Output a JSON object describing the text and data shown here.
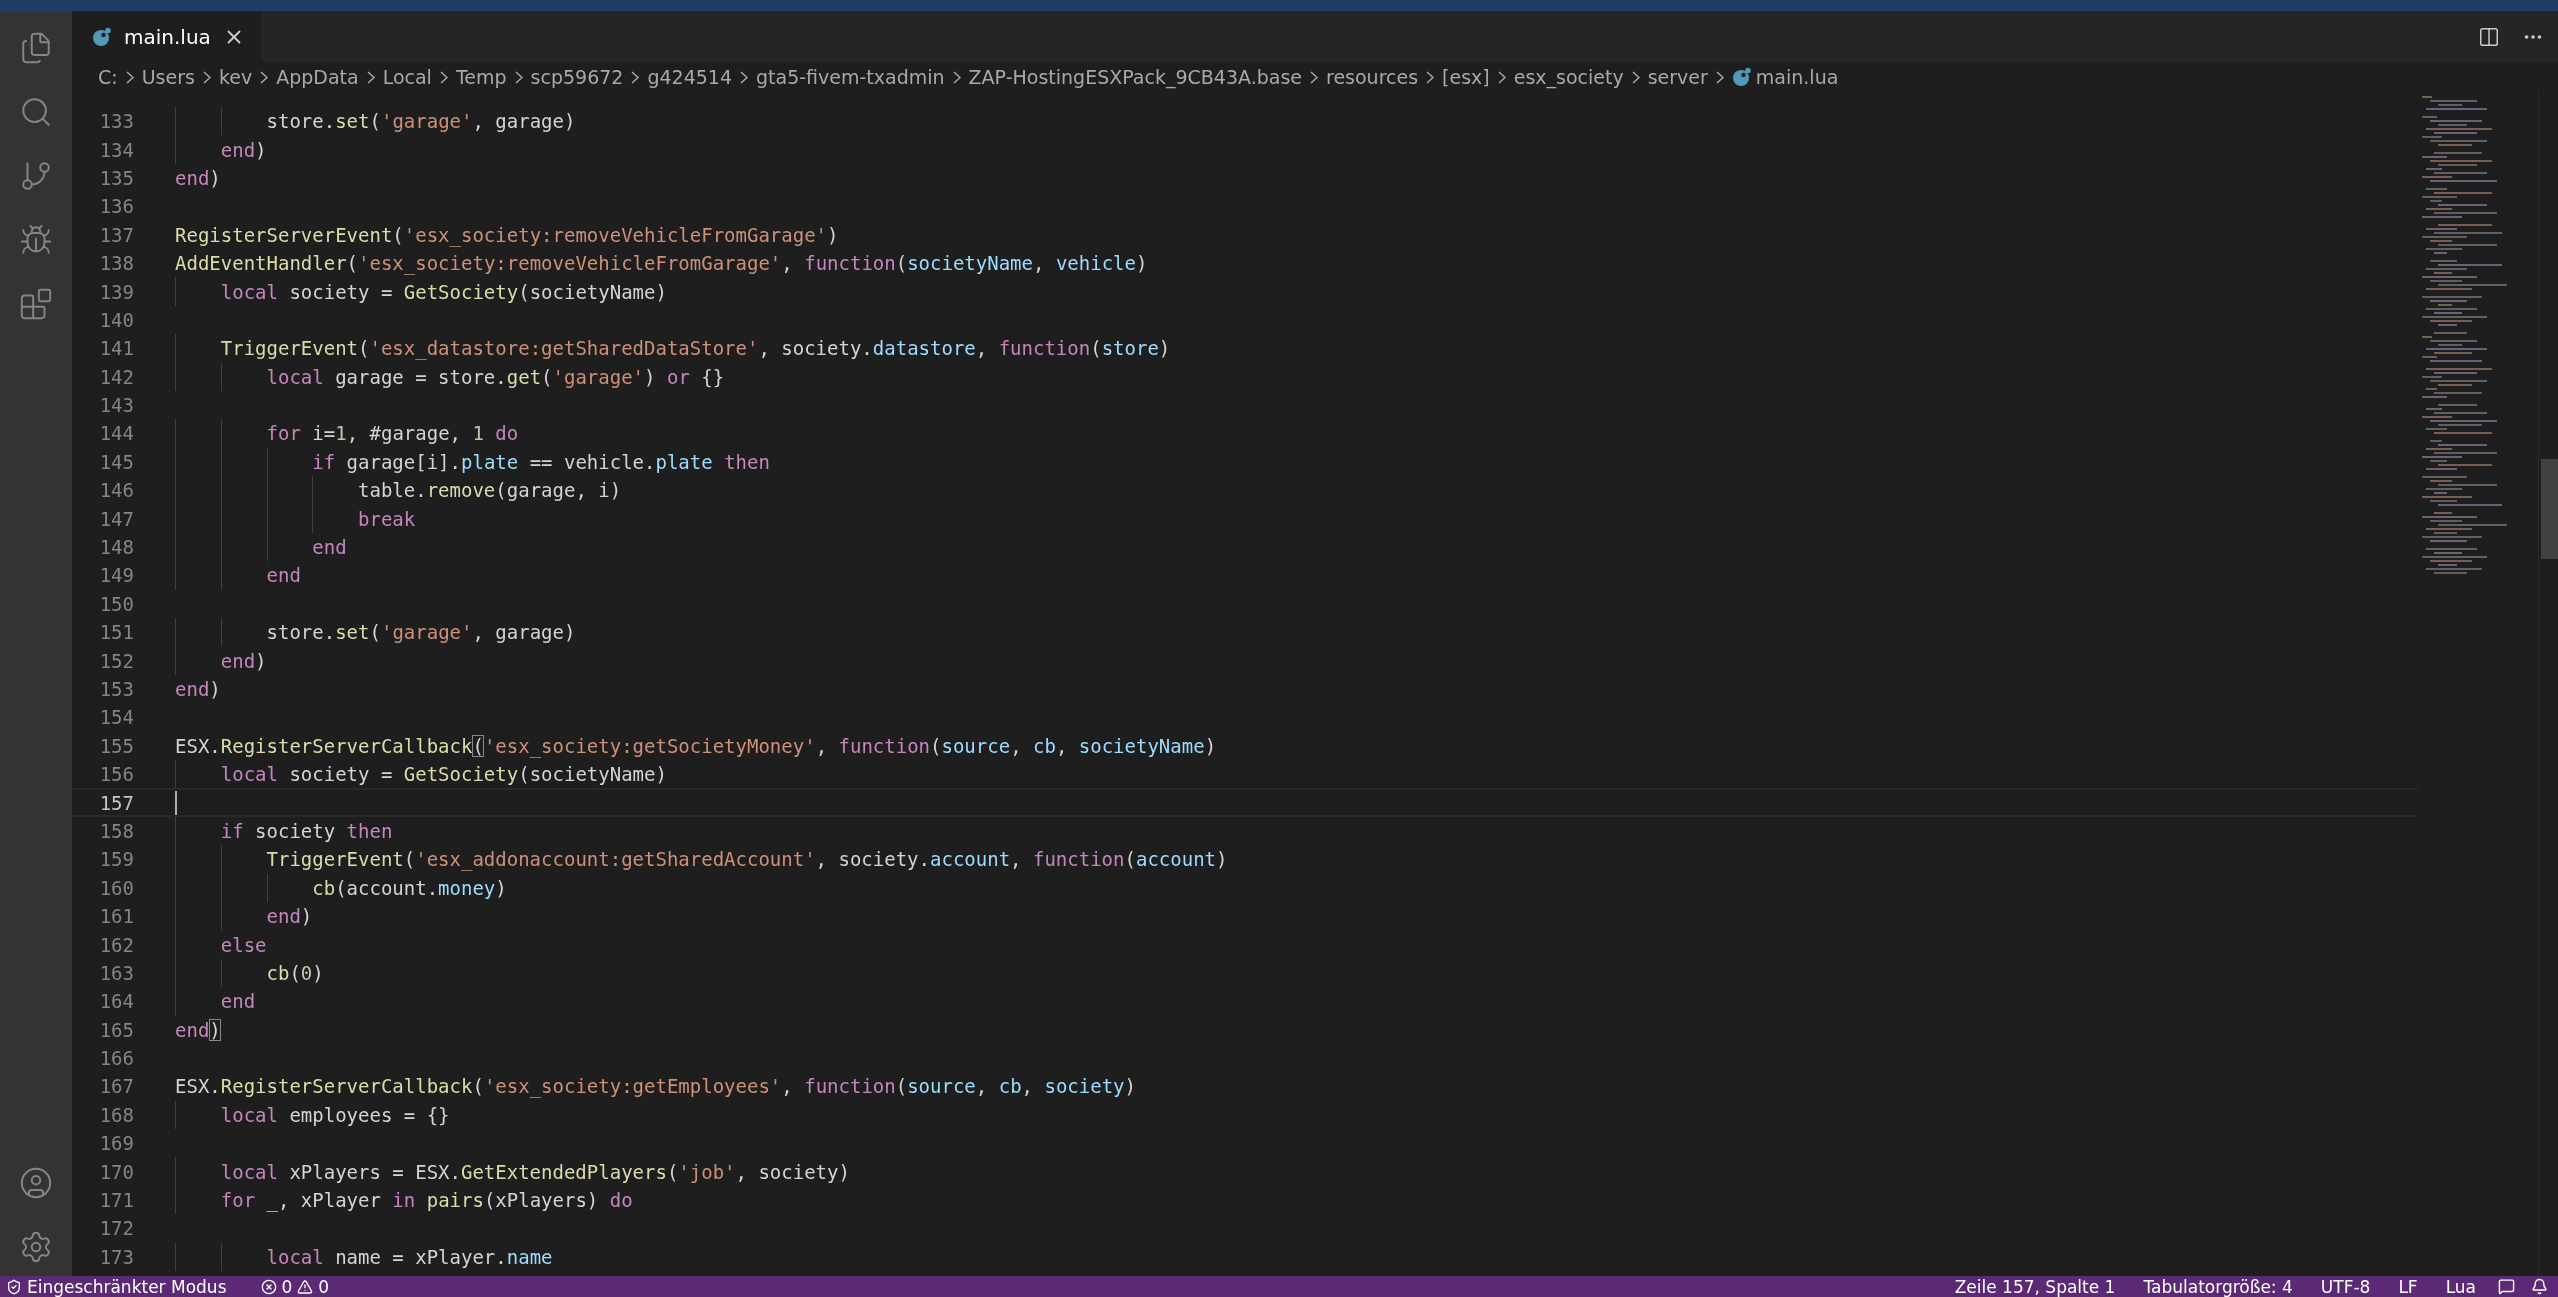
{
  "tabs": [
    {
      "label": "main.lua",
      "selected": true
    }
  ],
  "breadcrumbs": [
    "C:",
    "Users",
    "kev",
    "AppData",
    "Local",
    "Temp",
    "scp59672",
    "g424514",
    "gta5-fivem-txadmin",
    "ZAP-HostingESXPack_9CB43A.base",
    "resources",
    "[esx]",
    "esx_society",
    "server",
    "main.lua"
  ],
  "lines": [
    {
      "number": "133",
      "current": false,
      "tokens": [
        {
          "kind": "plain",
          "text": "        store."
        },
        {
          "kind": "fn",
          "text": "set"
        },
        {
          "kind": "plain",
          "text": "("
        },
        {
          "kind": "str",
          "text": "'garage'"
        },
        {
          "kind": "plain",
          "text": ", garage)"
        }
      ]
    },
    {
      "number": "134",
      "current": false,
      "tokens": [
        {
          "kind": "kw",
          "text": "    end"
        },
        {
          "kind": "plain",
          "text": ")"
        }
      ]
    },
    {
      "number": "135",
      "current": false,
      "tokens": [
        {
          "kind": "kw",
          "text": "end"
        },
        {
          "kind": "plain",
          "text": ")"
        }
      ]
    },
    {
      "number": "136",
      "current": false
    },
    {
      "number": "137",
      "current": false,
      "tokens": [
        {
          "kind": "fn",
          "text": "RegisterServerEvent"
        },
        {
          "kind": "plain",
          "text": "("
        },
        {
          "kind": "str",
          "text": "'esx_society:removeVehicleFromGarage'"
        },
        {
          "kind": "plain",
          "text": ")"
        }
      ]
    },
    {
      "number": "138",
      "current": false,
      "tokens": [
        {
          "kind": "fn",
          "text": "AddEventHandler"
        },
        {
          "kind": "plain",
          "text": "("
        },
        {
          "kind": "str",
          "text": "'esx_society:removeVehicleFromGarage'"
        },
        {
          "kind": "plain",
          "text": ", "
        },
        {
          "kind": "kw",
          "text": "function"
        },
        {
          "kind": "plain",
          "text": "("
        },
        {
          "kind": "var",
          "text": "societyName"
        },
        {
          "kind": "plain",
          "text": ", "
        },
        {
          "kind": "var",
          "text": "vehicle"
        },
        {
          "kind": "plain",
          "text": ")"
        }
      ]
    },
    {
      "number": "139",
      "current": false,
      "tokens": [
        {
          "kind": "kw",
          "text": "    local"
        },
        {
          "kind": "plain",
          "text": " society = "
        },
        {
          "kind": "fn",
          "text": "GetSociety"
        },
        {
          "kind": "plain",
          "text": "(societyName)"
        }
      ]
    },
    {
      "number": "140",
      "current": false
    },
    {
      "number": "141",
      "current": false,
      "tokens": [
        {
          "kind": "fn",
          "text": "    TriggerEvent"
        },
        {
          "kind": "plain",
          "text": "("
        },
        {
          "kind": "str",
          "text": "'esx_datastore:getSharedDataStore'"
        },
        {
          "kind": "plain",
          "text": ", society."
        },
        {
          "kind": "var",
          "text": "datastore"
        },
        {
          "kind": "plain",
          "text": ", "
        },
        {
          "kind": "kw",
          "text": "function"
        },
        {
          "kind": "plain",
          "text": "("
        },
        {
          "kind": "var",
          "text": "store"
        },
        {
          "kind": "plain",
          "text": ")"
        }
      ]
    },
    {
      "number": "142",
      "current": false,
      "tokens": [
        {
          "kind": "kw",
          "text": "        local"
        },
        {
          "kind": "plain",
          "text": " garage = store."
        },
        {
          "kind": "fn",
          "text": "get"
        },
        {
          "kind": "plain",
          "text": "("
        },
        {
          "kind": "str",
          "text": "'garage'"
        },
        {
          "kind": "plain",
          "text": ") "
        },
        {
          "kind": "kw",
          "text": "or"
        },
        {
          "kind": "plain",
          "text": " {}"
        }
      ]
    },
    {
      "number": "143",
      "current": false
    },
    {
      "number": "144",
      "current": false,
      "tokens": [
        {
          "kind": "kw",
          "text": "        for"
        },
        {
          "kind": "plain",
          "text": " i="
        },
        {
          "kind": "num",
          "text": "1"
        },
        {
          "kind": "plain",
          "text": ", #garage, "
        },
        {
          "kind": "num",
          "text": "1"
        },
        {
          "kind": "kw",
          "text": " do"
        }
      ]
    },
    {
      "number": "145",
      "current": false,
      "tokens": [
        {
          "kind": "kw",
          "text": "            if"
        },
        {
          "kind": "plain",
          "text": " garage[i]."
        },
        {
          "kind": "var",
          "text": "plate"
        },
        {
          "kind": "plain",
          "text": " == vehicle."
        },
        {
          "kind": "var",
          "text": "plate"
        },
        {
          "kind": "kw",
          "text": " then"
        }
      ]
    },
    {
      "number": "146",
      "current": false,
      "tokens": [
        {
          "kind": "plain",
          "text": "                table."
        },
        {
          "kind": "fn",
          "text": "remove"
        },
        {
          "kind": "plain",
          "text": "(garage, i)"
        }
      ]
    },
    {
      "number": "147",
      "current": false,
      "tokens": [
        {
          "kind": "kw",
          "text": "                break"
        }
      ]
    },
    {
      "number": "148",
      "current": false,
      "tokens": [
        {
          "kind": "kw",
          "text": "            end"
        }
      ]
    },
    {
      "number": "149",
      "current": false,
      "tokens": [
        {
          "kind": "kw",
          "text": "        end"
        }
      ]
    },
    {
      "number": "150",
      "current": false
    },
    {
      "number": "151",
      "current": false,
      "tokens": [
        {
          "kind": "plain",
          "text": "        store."
        },
        {
          "kind": "fn",
          "text": "set"
        },
        {
          "kind": "plain",
          "text": "("
        },
        {
          "kind": "str",
          "text": "'garage'"
        },
        {
          "kind": "plain",
          "text": ", garage)"
        }
      ]
    },
    {
      "number": "152",
      "current": false,
      "tokens": [
        {
          "kind": "kw",
          "text": "    end"
        },
        {
          "kind": "plain",
          "text": ")"
        }
      ]
    },
    {
      "number": "153",
      "current": false,
      "tokens": [
        {
          "kind": "kw",
          "text": "end"
        },
        {
          "kind": "plain",
          "text": ")"
        }
      ]
    },
    {
      "number": "154",
      "current": false
    },
    {
      "number": "155",
      "current": false,
      "tokens": [
        {
          "kind": "plain",
          "text": "ESX."
        },
        {
          "kind": "fn",
          "text": "RegisterServerCallback"
        },
        {
          "kind": "bracket",
          "text": "("
        },
        {
          "kind": "str",
          "text": "'esx_society:getSocietyMoney'"
        },
        {
          "kind": "plain",
          "text": ", "
        },
        {
          "kind": "kw",
          "text": "function"
        },
        {
          "kind": "plain",
          "text": "("
        },
        {
          "kind": "var",
          "text": "source"
        },
        {
          "kind": "plain",
          "text": ", "
        },
        {
          "kind": "var",
          "text": "cb"
        },
        {
          "kind": "plain",
          "text": ", "
        },
        {
          "kind": "var",
          "text": "societyName"
        },
        {
          "kind": "plain",
          "text": ")"
        }
      ]
    },
    {
      "number": "156",
      "current": false,
      "tokens": [
        {
          "kind": "kw",
          "text": "    local"
        },
        {
          "kind": "plain",
          "text": " society = "
        },
        {
          "kind": "fn",
          "text": "GetSociety"
        },
        {
          "kind": "plain",
          "text": "(societyName)"
        }
      ]
    },
    {
      "number": "157",
      "current": true
    },
    {
      "number": "158",
      "current": false,
      "tokens": [
        {
          "kind": "kw",
          "text": "    if"
        },
        {
          "kind": "plain",
          "text": " society "
        },
        {
          "kind": "kw",
          "text": "then"
        }
      ]
    },
    {
      "number": "159",
      "current": false,
      "tokens": [
        {
          "kind": "fn",
          "text": "        TriggerEvent"
        },
        {
          "kind": "plain",
          "text": "("
        },
        {
          "kind": "str",
          "text": "'esx_addonaccount:getSharedAccount'"
        },
        {
          "kind": "plain",
          "text": ", society."
        },
        {
          "kind": "var",
          "text": "account"
        },
        {
          "kind": "plain",
          "text": ", "
        },
        {
          "kind": "kw",
          "text": "function"
        },
        {
          "kind": "plain",
          "text": "("
        },
        {
          "kind": "var",
          "text": "account"
        },
        {
          "kind": "plain",
          "text": ")"
        }
      ]
    },
    {
      "number": "160",
      "current": false,
      "tokens": [
        {
          "kind": "fn",
          "text": "            cb"
        },
        {
          "kind": "plain",
          "text": "(account."
        },
        {
          "kind": "var",
          "text": "money"
        },
        {
          "kind": "plain",
          "text": ")"
        }
      ]
    },
    {
      "number": "161",
      "current": false,
      "tokens": [
        {
          "kind": "kw",
          "text": "        end"
        },
        {
          "kind": "plain",
          "text": ")"
        }
      ]
    },
    {
      "number": "162",
      "current": false,
      "tokens": [
        {
          "kind": "kw",
          "text": "    else"
        }
      ]
    },
    {
      "number": "163",
      "current": false,
      "tokens": [
        {
          "kind": "fn",
          "text": "        cb"
        },
        {
          "kind": "plain",
          "text": "("
        },
        {
          "kind": "num",
          "text": "0"
        },
        {
          "kind": "plain",
          "text": ")"
        }
      ]
    },
    {
      "number": "164",
      "current": false,
      "tokens": [
        {
          "kind": "kw",
          "text": "    end"
        }
      ]
    },
    {
      "number": "165",
      "current": false,
      "tokens": [
        {
          "kind": "kw",
          "text": "end"
        },
        {
          "kind": "bracket",
          "text": ")"
        }
      ]
    },
    {
      "number": "166",
      "current": false
    },
    {
      "number": "167",
      "current": false,
      "tokens": [
        {
          "kind": "plain",
          "text": "ESX."
        },
        {
          "kind": "fn",
          "text": "RegisterServerCallback"
        },
        {
          "kind": "plain",
          "text": "("
        },
        {
          "kind": "str",
          "text": "'esx_society:getEmployees'"
        },
        {
          "kind": "plain",
          "text": ", "
        },
        {
          "kind": "kw",
          "text": "function"
        },
        {
          "kind": "plain",
          "text": "("
        },
        {
          "kind": "var",
          "text": "source"
        },
        {
          "kind": "plain",
          "text": ", "
        },
        {
          "kind": "var",
          "text": "cb"
        },
        {
          "kind": "plain",
          "text": ", "
        },
        {
          "kind": "var",
          "text": "society"
        },
        {
          "kind": "plain",
          "text": ")"
        }
      ]
    },
    {
      "number": "168",
      "current": false,
      "tokens": [
        {
          "kind": "kw",
          "text": "    local"
        },
        {
          "kind": "plain",
          "text": " employees = {}"
        }
      ]
    },
    {
      "number": "169",
      "current": false
    },
    {
      "number": "170",
      "current": false,
      "tokens": [
        {
          "kind": "kw",
          "text": "    local"
        },
        {
          "kind": "plain",
          "text": " xPlayers = ESX."
        },
        {
          "kind": "fn",
          "text": "GetExtendedPlayers"
        },
        {
          "kind": "plain",
          "text": "("
        },
        {
          "kind": "str",
          "text": "'job'"
        },
        {
          "kind": "plain",
          "text": ", society)"
        }
      ]
    },
    {
      "number": "171",
      "current": false,
      "tokens": [
        {
          "kind": "kw",
          "text": "    for"
        },
        {
          "kind": "plain",
          "text": " _, xPlayer "
        },
        {
          "kind": "kw",
          "text": "in"
        },
        {
          "kind": "fn",
          "text": " pairs"
        },
        {
          "kind": "plain",
          "text": "(xPlayers) "
        },
        {
          "kind": "kw",
          "text": "do"
        }
      ]
    },
    {
      "number": "172",
      "current": false
    },
    {
      "number": "173",
      "current": false,
      "tokens": [
        {
          "kind": "kw",
          "text": "        local"
        },
        {
          "kind": "plain",
          "text": " name = xPlayer."
        },
        {
          "kind": "var",
          "text": "name"
        }
      ]
    }
  ],
  "status_bar": {
    "mode": "Eingeschränkter Modus",
    "errors": "0",
    "warnings": "0",
    "right": [
      "Zeile 157, Spalte 1",
      "Tabulatorgröße: 4",
      "UTF-8",
      "LF",
      "Lua"
    ]
  }
}
